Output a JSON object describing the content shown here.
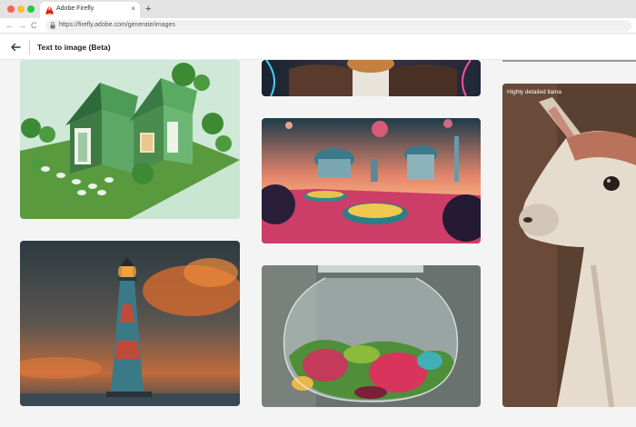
{
  "browser": {
    "tab_title": "Adobe Firefly",
    "tab_close": "×",
    "new_tab": "+",
    "url": "https://firefly.adobe.com/generate/images",
    "nav": {
      "back": "←",
      "forward": "→",
      "reload": "C"
    }
  },
  "header": {
    "title": "Text to image (Beta)"
  },
  "gallery": {
    "images": [
      {
        "subject": "isometric green houses"
      },
      {
        "subject": "portrait in leather jacket"
      },
      {
        "subject": "alien planet city"
      },
      {
        "subject": "lighthouse at sunset"
      },
      {
        "subject": "terrarium in glass jar"
      },
      {
        "subject": "llama",
        "caption": "Highly detailed llama"
      }
    ]
  },
  "colors": {
    "adobe_red": "#eb1000",
    "page_bg": "#f4f4f4"
  }
}
